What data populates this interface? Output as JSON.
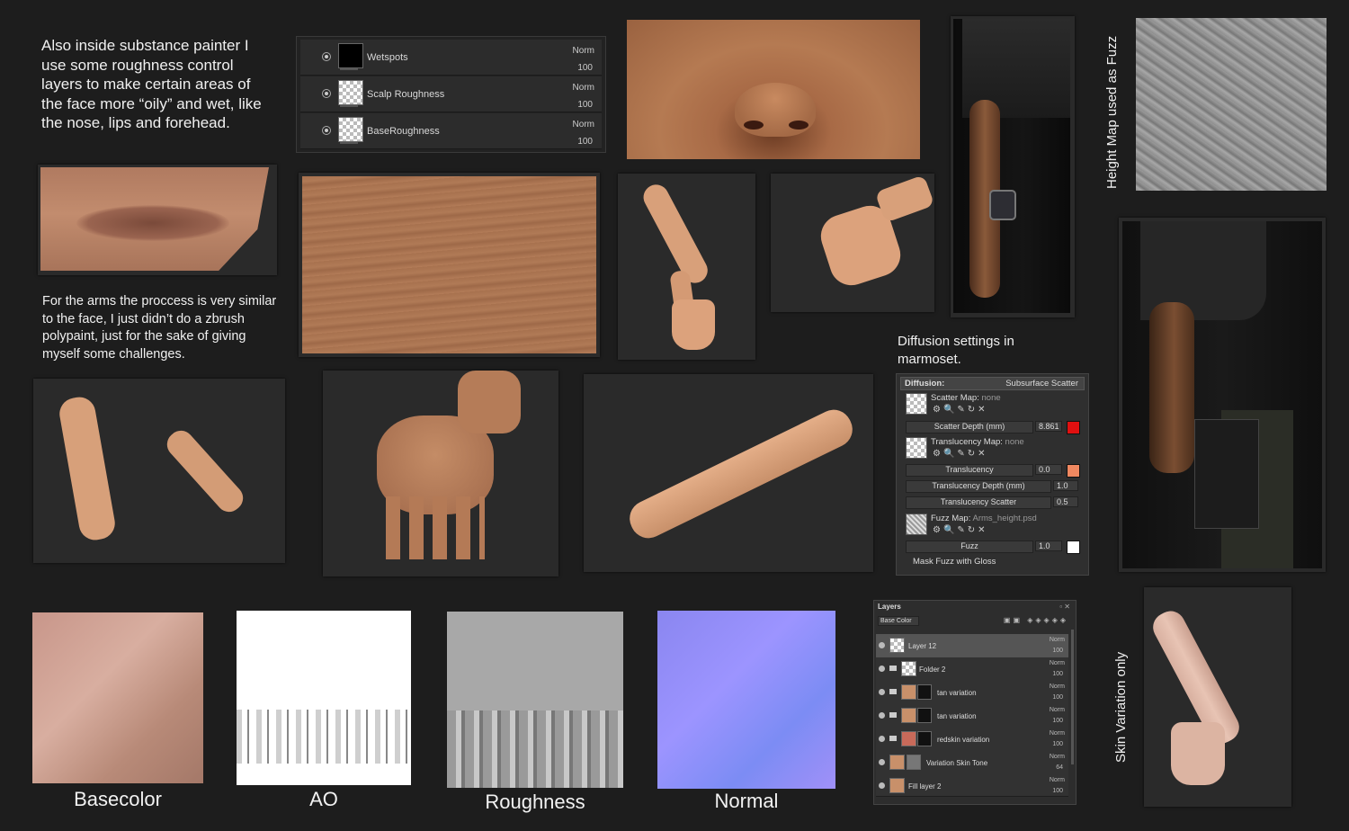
{
  "notes": {
    "roughness": "Also inside substance painter I use some roughness control layers to make certain areas of the face more “oily” and wet, like the nose, lips and forehead.",
    "arms": "For the arms the proccess is very similar to the face, I just didn’t do a zbrush polypaint, just for the sake of giving myself some challenges.",
    "diffusion": "Diffusion settings in marmoset.",
    "height_map": "Height Map used as Fuzz",
    "skin_variation": "Skin Variation only"
  },
  "roughness_layers": [
    {
      "name": "Wetspots",
      "blend": "Norm",
      "opacity": "100",
      "thumb": "black"
    },
    {
      "name": "Scalp Roughness",
      "blend": "Norm",
      "opacity": "100",
      "thumb": "checker"
    },
    {
      "name": "BaseRoughness",
      "blend": "Norm",
      "opacity": "100",
      "thumb": "checker"
    }
  ],
  "marmoset": {
    "header": "Diffusion:",
    "mode": "Subsurface Scatter",
    "scatter_map_label": "Scatter Map:",
    "scatter_map_value": "none",
    "scatter_depth_label": "Scatter Depth (mm)",
    "scatter_depth_value": "8.861",
    "translucency_map_label": "Translucency Map:",
    "translucency_map_value": "none",
    "translucency_label": "Translucency",
    "translucency_value": "0.0",
    "translucency_depth_label": "Translucency Depth (mm)",
    "translucency_depth_value": "1.0",
    "translucency_scatter_label": "Translucency Scatter",
    "translucency_scatter_value": "0.5",
    "fuzz_map_label": "Fuzz Map:",
    "fuzz_map_value": "Arms_height.psd",
    "fuzz_label": "Fuzz",
    "fuzz_value": "1.0",
    "mask_label": "Mask Fuzz with Gloss",
    "scatter_color": "#e01010",
    "translucency_color": "#f08860",
    "fuzz_color": "#ffffff"
  },
  "layers_panel": {
    "title": "Layers",
    "channel": "Base Color",
    "layers": [
      {
        "name": "Layer 12",
        "blend": "Norm",
        "opacity": "100"
      },
      {
        "name": "Folder 2",
        "blend": "Norm",
        "opacity": "100"
      },
      {
        "name": "tan variation",
        "blend": "Norm",
        "opacity": "100"
      },
      {
        "name": "tan variation",
        "blend": "Norm",
        "opacity": "100"
      },
      {
        "name": "redskin variation",
        "blend": "Norm",
        "opacity": "100"
      },
      {
        "name": "Variation Skin Tone",
        "blend": "Norm",
        "opacity": "64"
      },
      {
        "name": "Fill layer 2",
        "blend": "Norm",
        "opacity": "100"
      }
    ]
  },
  "texture_captions": [
    "Basecolor",
    "AO",
    "Roughness",
    "Normal"
  ]
}
